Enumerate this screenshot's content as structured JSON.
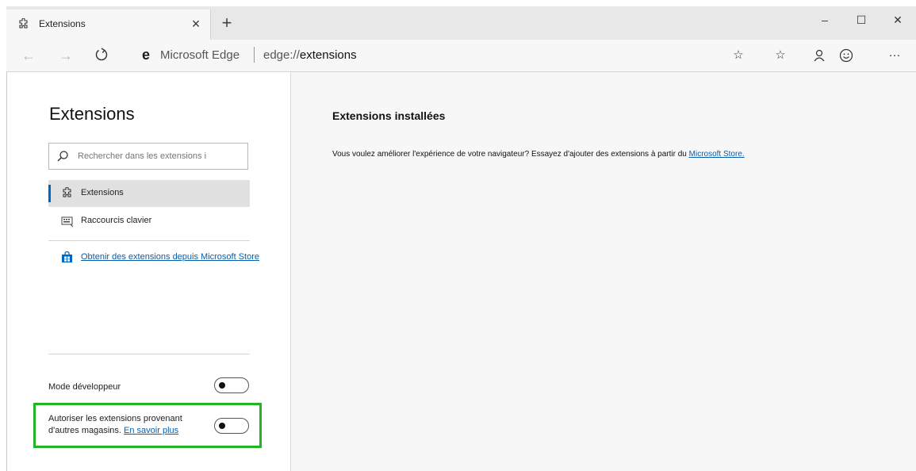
{
  "browser": {
    "tab": {
      "title": "Extensions",
      "close_glyph": "×"
    },
    "new_tab_glyph": "+",
    "window_controls": {
      "minimize": "–",
      "maximize": "☐",
      "close": "✕"
    }
  },
  "address_bar": {
    "brand": "Microsoft Edge",
    "url_prefix": "edge://",
    "url_path": "extensions"
  },
  "sidebar": {
    "title": "Extensions",
    "search_placeholder": "Rechercher dans les extensions i",
    "nav": [
      {
        "label": "Extensions",
        "icon": "puzzle-icon",
        "active": true
      },
      {
        "label": "Raccourcis clavier",
        "icon": "keyboard-icon",
        "active": false
      }
    ],
    "store_link": "Obtenir des extensions depuis Microsoft Store",
    "developer_mode": {
      "label": "Mode développeur",
      "enabled": false
    },
    "other_stores": {
      "label_before": "Autoriser les extensions provenant d'autres magasins.",
      "link": "En savoir plus",
      "enabled": false
    }
  },
  "main": {
    "title": "Extensions installées",
    "description": "Vous voulez améliorer l'expérience de votre navigateur? Essayez d'ajouter des extensions à partir du",
    "store_link": "Microsoft Store."
  },
  "colors": {
    "accent": "#0067c0",
    "link": "#0a5ea8",
    "highlight_border": "#22b522"
  }
}
